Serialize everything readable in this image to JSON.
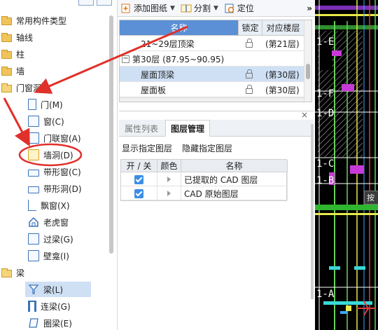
{
  "tree": {
    "items": [
      {
        "label": "常用构件类型",
        "icon": "folder-icon"
      },
      {
        "label": "轴线",
        "icon": "folder-icon"
      },
      {
        "label": "柱",
        "icon": "folder-icon"
      },
      {
        "label": "墙",
        "icon": "folder-icon"
      },
      {
        "label": "门窗洞",
        "icon": "folder-open-icon"
      },
      {
        "label": "门(M)",
        "icon": "door-icon"
      },
      {
        "label": "窗(C)",
        "icon": "window-icon"
      },
      {
        "label": "门联窗(A)",
        "icon": "door-window-icon"
      },
      {
        "label": "墙洞(D)",
        "icon": "wall-opening-icon"
      },
      {
        "label": "带形窗(C)",
        "icon": "strip-window-icon"
      },
      {
        "label": "带形洞(D)",
        "icon": "strip-opening-icon"
      },
      {
        "label": "飘窗(X)",
        "icon": "bay-window-icon"
      },
      {
        "label": "老虎窗",
        "icon": "dormer-window-icon"
      },
      {
        "label": "过梁(G)",
        "icon": "lintel-icon"
      },
      {
        "label": "壁龛(I)",
        "icon": "niche-icon"
      },
      {
        "label": "梁",
        "icon": "folder-open-icon"
      },
      {
        "label": "梁(L)",
        "icon": "beam-icon"
      },
      {
        "label": "连梁(G)",
        "icon": "coupling-beam-icon"
      },
      {
        "label": "圈梁(E)",
        "icon": "ring-beam-icon"
      }
    ]
  },
  "toolbar": {
    "add_drawing": "添加图纸",
    "split": "分割",
    "locate": "定位",
    "more": "»"
  },
  "floor_table": {
    "headers": {
      "name": "名称",
      "lock": "锁定",
      "floor": "对应楼层"
    },
    "rows": [
      {
        "name": "21~29层顶梁",
        "lock": false,
        "floor": "(第21层)",
        "type": "item"
      },
      {
        "name": "第30层 (87.95~90.95)",
        "type": "group",
        "toggle": "−"
      },
      {
        "name": "屋面顶梁",
        "lock": true,
        "floor": "(第30层)",
        "type": "item",
        "selected": true
      },
      {
        "name": "屋面板",
        "lock": true,
        "floor": "(第30层)",
        "type": "item"
      }
    ]
  },
  "layer_panel": {
    "close": "×",
    "tabs": [
      {
        "label": "属性列表",
        "active": false
      },
      {
        "label": "图层管理",
        "active": true
      }
    ],
    "show_layer": "显示指定图层",
    "hide_layer": "隐藏指定图层",
    "headers": {
      "toggle": "开 / 关",
      "color": "颜色",
      "name": "名称"
    },
    "rows": [
      {
        "on": true,
        "name": "已提取的 CAD 图层"
      },
      {
        "on": true,
        "name": "CAD 原始图层"
      }
    ]
  },
  "cad": {
    "axis_labels": [
      "1-E",
      "1-F",
      "1-D",
      "1-C",
      "1-B",
      "1-A"
    ],
    "tooltip": "按"
  },
  "colors": {
    "annotation": "#e0302a",
    "selection": "#cfe0f5",
    "header_accent": "#5b8fd6",
    "checkbox": "#3d8ee6"
  }
}
